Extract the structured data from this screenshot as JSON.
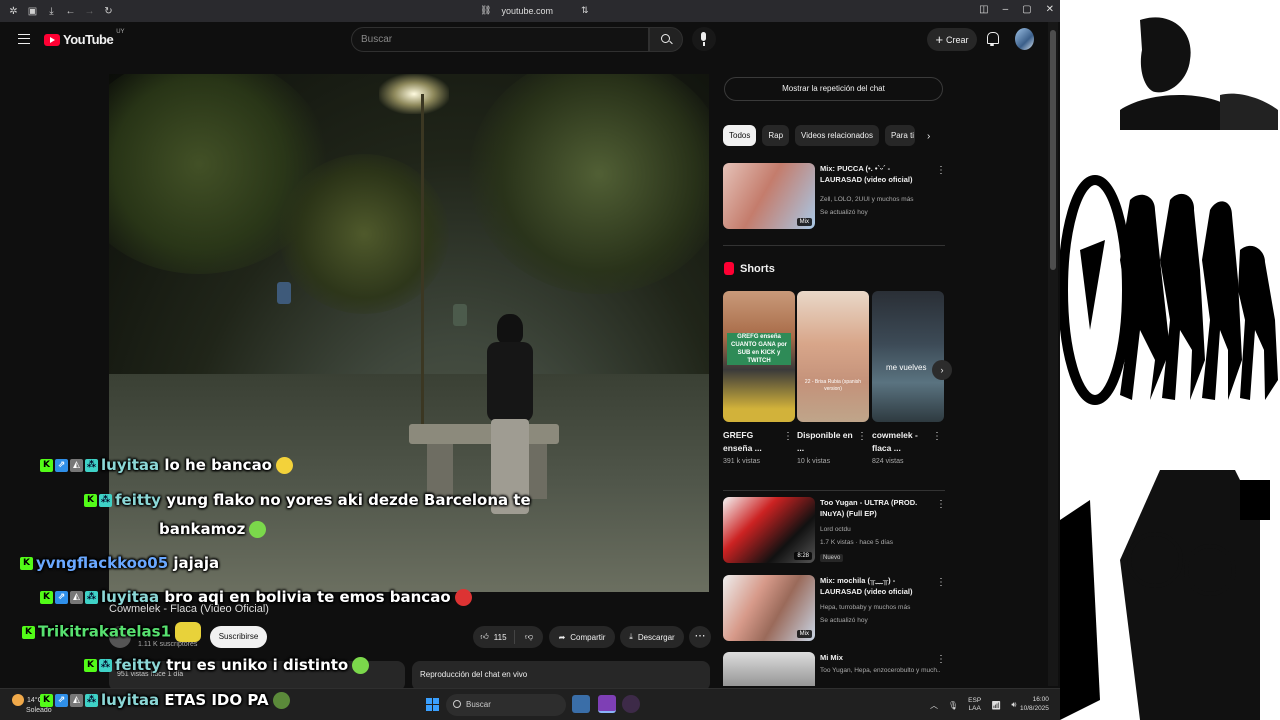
{
  "browser": {
    "url": "youtube.com"
  },
  "header": {
    "logo": "YouTube",
    "logo_country": "UY",
    "search_placeholder": "Buscar",
    "create_label": "Crear"
  },
  "video": {
    "title": "Cowmelek - Flaca (Video Oficial)",
    "channel_subs": "1.11 K suscriptores",
    "subscribe_label": "Suscribirse",
    "likes": "115",
    "share_label": "Compartir",
    "download_label": "Descargar",
    "description_snippet": "951 vistas  hace 1 día",
    "chat_replay_label": "Reproducción del chat en vivo"
  },
  "sidebar": {
    "chat_replay_button": "Mostrar la repetición del chat",
    "chips": [
      "Todos",
      "Rap",
      "Videos relacionados",
      "Para ti"
    ],
    "recommendations_top": [
      {
        "title": "Mix: PUCCA (•. •`ᵕ´ - LAURASAD (video oficial)",
        "meta1": "Zell, LOLO, 2UUI y muchos más",
        "meta2": "Se actualizó hoy",
        "badge": "Mix"
      }
    ],
    "shorts_heading": "Shorts",
    "shorts": [
      {
        "title": "GREFG enseña ...",
        "views": "391 k vistas"
      },
      {
        "title": "Disponible en ...",
        "views": "10 k vistas"
      },
      {
        "title": "cowmelek - flaca ...",
        "views": "824 vistas"
      }
    ],
    "short_overlay_text": [
      "GREFG enseña CUANTO GANA por SUB en KICK y TWITCH",
      "22 - Brisa Rubia (spanish version)",
      "me vuelves"
    ],
    "recommendations_bottom": [
      {
        "title": "Too Yugan - ULTRA (PROD. INuYA) (Full EP)",
        "meta1": "Lord octdu",
        "meta2": "1.7 K vistas · hace 5 días",
        "badge": "8:28",
        "new_label": "Nuevo"
      },
      {
        "title": "Mix: mochila (╥﹏╥) - LAURASAD (video oficial)",
        "meta1": "Hepa, turrobaby y muchos más",
        "meta2": "Se actualizó hoy",
        "badge": "Mix"
      },
      {
        "title": "Mi Mix",
        "meta1": "Too Yugan, Hepa, enzocerobulto y much...",
        "meta2": "",
        "badge": ""
      }
    ]
  },
  "chat_overlay": [
    {
      "user": "luyitaa",
      "message": "lo he bancao"
    },
    {
      "user": "feitty",
      "message": "yung flako no yores aki dezde Barcelona te"
    },
    {
      "user": "",
      "message": "bankamoz"
    },
    {
      "user": "yvngflackkoo05",
      "message": "jajaja"
    },
    {
      "user": "luyitaa",
      "message": "bro aqi en bolivia te emos bancao"
    },
    {
      "user": "Trikitrakatelas1",
      "message": ""
    },
    {
      "user": "feitty",
      "message": "tru es uniko i distinto"
    },
    {
      "user": "luyitaa",
      "message": "ETAS IDO PA"
    }
  ],
  "taskbar": {
    "weather_temp": "14°C",
    "weather_desc": "Soleado",
    "search_label": "Buscar",
    "lang_top": "ESP",
    "lang_bottom": "LAA",
    "time": "16:00",
    "date": "10/8/2025"
  },
  "icons": {
    "search": "search-icon",
    "mic": "mic-icon",
    "bell": "bell-icon",
    "like": "thumbs-up-icon",
    "dislike": "thumbs-down-icon",
    "share": "share-icon",
    "download": "download-icon"
  },
  "colors": {
    "background": "#0f0f0f",
    "brand_red": "#ff0033",
    "kick_green": "#53fc18"
  }
}
